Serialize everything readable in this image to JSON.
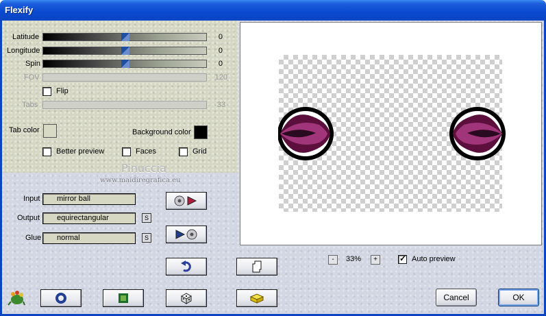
{
  "window": {
    "title": "Flexify"
  },
  "sliders": [
    {
      "label": "Latitude",
      "value": "0",
      "fraction": 0.5,
      "enabled": true
    },
    {
      "label": "Longitude",
      "value": "0",
      "fraction": 0.5,
      "enabled": true
    },
    {
      "label": "Spin",
      "value": "0",
      "fraction": 0.5,
      "enabled": true
    },
    {
      "label": "FOV",
      "value": "120",
      "fraction": null,
      "enabled": false
    },
    {
      "label": "Tabs",
      "value": "33",
      "fraction": null,
      "enabled": false
    }
  ],
  "flip": {
    "label": "Flip",
    "checked": false
  },
  "colors": {
    "tab_color_label": "Tab color",
    "tab_color": "#d8dac6",
    "background_color_label": "Background color",
    "background_color": "#000000",
    "accent": "#0c45c2"
  },
  "options": {
    "better_preview": {
      "label": "Better preview",
      "checked": false
    },
    "faces": {
      "label": "Faces",
      "checked": false
    },
    "grid": {
      "label": "Grid",
      "checked": false
    }
  },
  "watermark": {
    "name": "Pinuccia",
    "site": "www.maidiregrafica.eu"
  },
  "io": {
    "input_label": "Input",
    "input_value": "mirror ball",
    "output_label": "Output",
    "output_value": "equirectangular",
    "glue_label": "Glue",
    "glue_value": "normal",
    "small_button": "S"
  },
  "zoom": {
    "minus": "-",
    "value": "33%",
    "plus": "+"
  },
  "auto_preview": {
    "label": "Auto preview",
    "checked": true
  },
  "buttons": {
    "cancel": "Cancel",
    "ok": "OK"
  },
  "icons": {
    "convert_forward": "disc-play-icon",
    "convert_back": "play-disc-icon",
    "undo": "undo-arrow-icon",
    "copy": "copy-pages-icon",
    "app": "lizard-logo-icon",
    "circle": "ring-icon",
    "square": "square-icon",
    "dice": "dice-icon",
    "preset": "yellow-block-icon"
  }
}
